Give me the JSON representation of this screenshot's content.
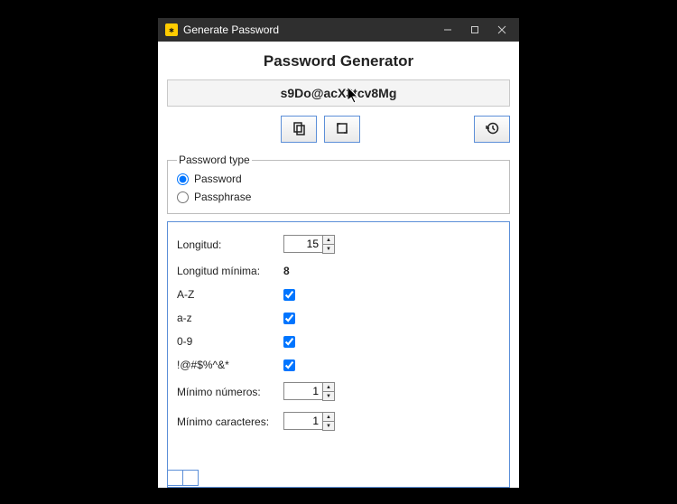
{
  "window": {
    "title": "Generate Password"
  },
  "header": {
    "title": "Password Generator"
  },
  "password_output": "s9Do@acX3tcv8Mg",
  "icons": {
    "copy": "copy-icon",
    "regenerate": "regenerate-icon",
    "history": "history-icon"
  },
  "password_type": {
    "legend": "Password type",
    "options": [
      {
        "label": "Password",
        "checked": true
      },
      {
        "label": "Passphrase",
        "checked": false
      }
    ]
  },
  "options": {
    "length": {
      "label": "Longitud:",
      "value": 15
    },
    "min_length": {
      "label": "Longitud mínima:",
      "value": "8"
    },
    "uppercase": {
      "label": "A-Z",
      "checked": true
    },
    "lowercase": {
      "label": "a-z",
      "checked": true
    },
    "digits": {
      "label": "0-9",
      "checked": true
    },
    "symbols": {
      "label": "!@#$%^&*",
      "checked": true
    },
    "min_numbers": {
      "label": "Mínimo números:",
      "value": 1
    },
    "min_special": {
      "label": "Mínimo caracteres:",
      "value": 1
    }
  }
}
